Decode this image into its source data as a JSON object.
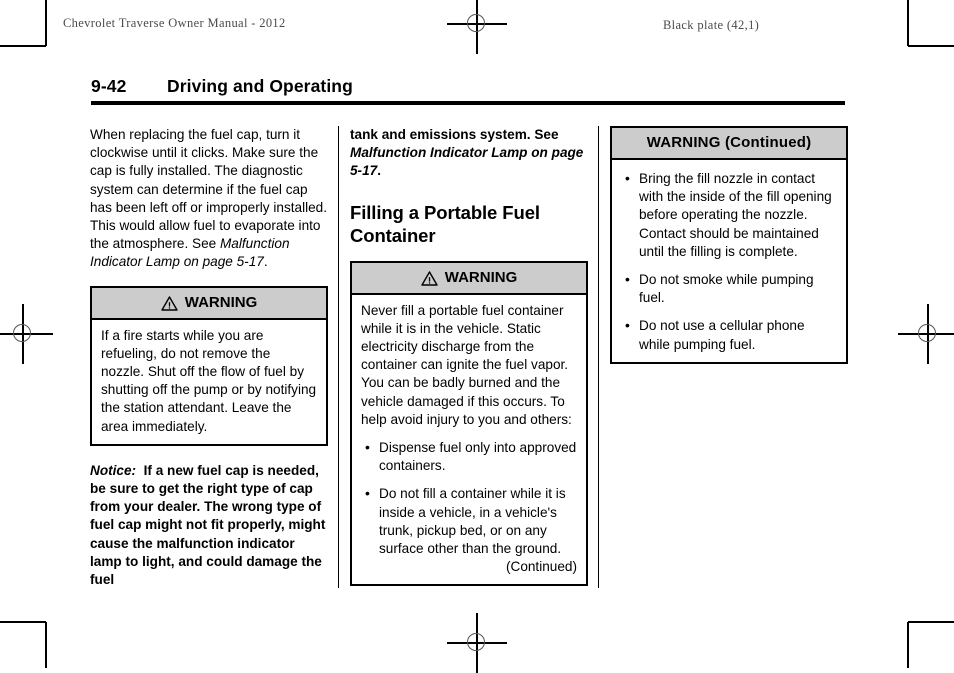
{
  "running_head": {
    "left": "Chevrolet Traverse Owner Manual - 2012",
    "right": "Black plate (42,1)"
  },
  "page_title": {
    "number": "9-42",
    "heading": "Driving and Operating"
  },
  "columns": {
    "col1": {
      "paragraph_1": "When replacing the fuel cap, turn it clockwise until it clicks. Make sure the cap is fully installed. The diagnostic system can determine if the fuel cap has been left off or improperly installed. This would allow fuel to evaporate into the atmosphere. See ",
      "paragraph_1_ref": "Malfunction Indicator Lamp on page 5-17",
      "paragraph_1_end": ".",
      "warning": {
        "title": "WARNING",
        "icon": "warning-triangle-icon",
        "body": "If a fire starts while you are refueling, do not remove the nozzle. Shut off the flow of fuel by shutting off the pump or by notifying the station attendant. Leave the area immediately."
      },
      "notice_label": "Notice:",
      "notice_body": "If a new fuel cap is needed, be sure to get the right type of cap from your dealer. The wrong type of fuel cap might not fit properly, might cause the malfunction indicator lamp to light, and could damage the fuel"
    },
    "col2": {
      "continuation_text": "tank and emissions system. See ",
      "continuation_ref": "Malfunction Indicator Lamp on page 5-17",
      "continuation_end": ".",
      "section_heading": "Filling a Portable Fuel Container",
      "warning": {
        "title": "WARNING",
        "icon": "warning-triangle-icon",
        "body": "Never fill a portable fuel container while it is in the vehicle. Static electricity discharge from the container can ignite the fuel vapor. You can be badly burned and the vehicle damaged if this occurs. To help avoid injury to you and others:",
        "bullets": [
          "Dispense fuel only into approved containers.",
          "Do not fill a container while it is inside a vehicle, in a vehicle's trunk, pickup bed, or on any surface other than the ground."
        ],
        "continued_label": "(Continued)"
      }
    },
    "col3": {
      "warning": {
        "title": "WARNING  (Continued)",
        "bullets": [
          "Bring the fill nozzle in contact with the inside of the fill opening before operating the nozzle. Contact should be maintained until the filling is complete.",
          "Do not smoke while pumping fuel.",
          "Do not use a cellular phone while pumping fuel."
        ]
      }
    }
  },
  "print_marks": {
    "registration_icon": "registration-crosshair-icon",
    "crop_icon": "crop-mark-icon",
    "header_gray": "#cccccc"
  }
}
